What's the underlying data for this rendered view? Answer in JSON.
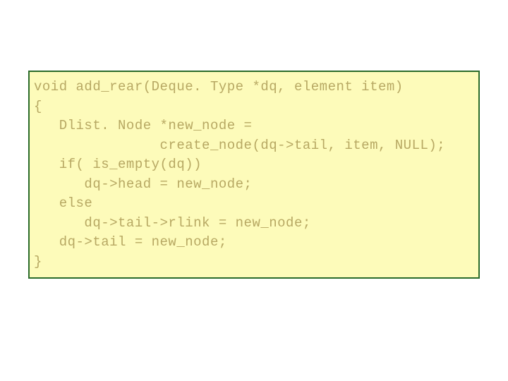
{
  "code": {
    "lines": [
      "void add_rear(Deque. Type *dq, element item)",
      "{",
      "   Dlist. Node *new_node =",
      "               create_node(dq->tail, item, NULL);",
      "",
      "   if( is_empty(dq))",
      "      dq->head = new_node;",
      "   else",
      "      dq->tail->rlink = new_node;",
      "   dq->tail = new_node;",
      "}"
    ]
  }
}
